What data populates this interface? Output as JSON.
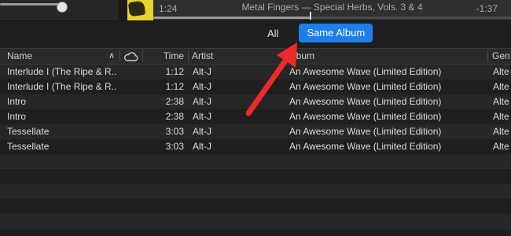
{
  "player": {
    "elapsed": "1:24",
    "track_title": "Metal Fingers — Special Herbs, Vols. 3 & 4",
    "remaining": "-1:37",
    "progress_fraction": 0.44
  },
  "filter": {
    "all_label": "All",
    "same_album_label": "Same Album",
    "selected": "Same Album"
  },
  "table": {
    "columns": {
      "name": "Name",
      "time": "Time",
      "artist": "Artist",
      "album": "Album",
      "genre": "Gen"
    },
    "rows": [
      {
        "name": "Interlude I (The Ripe & R...",
        "time": "1:12",
        "artist": "Alt-J",
        "album": "An Awesome Wave (Limited Edition)",
        "genre": "Alte"
      },
      {
        "name": "Interlude I (The Ripe & R...",
        "time": "1:12",
        "artist": "Alt-J",
        "album": "An Awesome Wave (Limited Edition)",
        "genre": "Alte"
      },
      {
        "name": "Intro",
        "time": "2:38",
        "artist": "Alt-J",
        "album": "An Awesome Wave (Limited Edition)",
        "genre": "Alte"
      },
      {
        "name": "Intro",
        "time": "2:38",
        "artist": "Alt-J",
        "album": "An Awesome Wave (Limited Edition)",
        "genre": "Alte"
      },
      {
        "name": "Tessellate",
        "time": "3:03",
        "artist": "Alt-J",
        "album": "An Awesome Wave (Limited Edition)",
        "genre": "Alte"
      },
      {
        "name": "Tessellate",
        "time": "3:03",
        "artist": "Alt-J",
        "album": "An Awesome Wave (Limited Edition)",
        "genre": "Alte"
      }
    ]
  },
  "icons": {
    "sort": "chevron-up-icon",
    "cloud": "cloud-icon"
  },
  "colors": {
    "accent": "#1e7fe9",
    "annotation_arrow": "#ef2a2a"
  }
}
